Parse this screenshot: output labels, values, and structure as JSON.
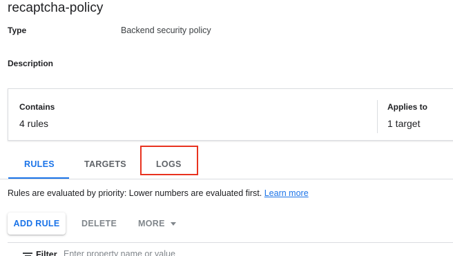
{
  "page_title": "recaptcha-policy",
  "details": {
    "type_label": "Type",
    "type_value": "Backend security policy",
    "description_label": "Description"
  },
  "summary": {
    "contains_label": "Contains",
    "contains_value": "4 rules",
    "applies_label": "Applies to",
    "applies_value": "1 target"
  },
  "tabs": [
    {
      "label": "RULES",
      "active": true
    },
    {
      "label": "TARGETS",
      "active": false
    },
    {
      "label": "LOGS",
      "active": false,
      "highlighted": true
    }
  ],
  "info": {
    "text": "Rules are evaluated by priority: Lower numbers are evaluated first.",
    "link": "Learn more"
  },
  "toolbar": {
    "add_rule": "ADD RULE",
    "delete": "DELETE",
    "more": "MORE"
  },
  "filter": {
    "label": "Filter",
    "placeholder": "Enter property name or value"
  },
  "colors": {
    "accent": "#1a73e8",
    "highlight": "#e8321f"
  }
}
